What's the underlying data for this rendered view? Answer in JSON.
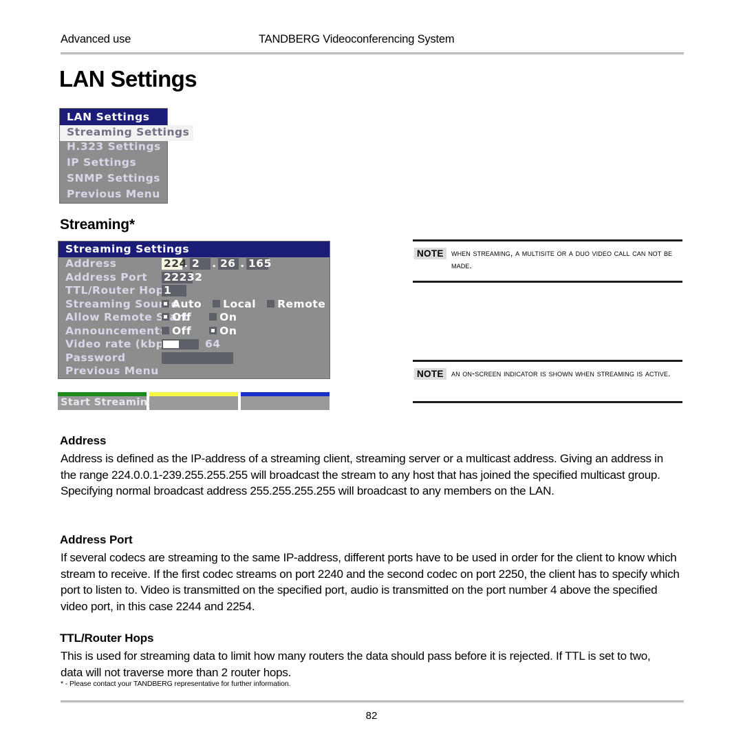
{
  "header": {
    "left": "Advanced use",
    "center": "TANDBERG Videoconferencing System"
  },
  "page_title": "LAN Settings",
  "lan_menu": {
    "title": "LAN Settings",
    "items": [
      {
        "label": "Streaming Settings",
        "selected": true
      },
      {
        "label": "H.323 Settings",
        "selected": false
      },
      {
        "label": "IP Settings",
        "selected": false
      },
      {
        "label": "SNMP Settings",
        "selected": false
      },
      {
        "label": "Previous Menu",
        "selected": false
      }
    ]
  },
  "streaming_section_heading": "Streaming*",
  "streaming_menu": {
    "title": "Streaming Settings",
    "rows": {
      "address": {
        "label": "Address",
        "octets": [
          "224",
          "2",
          "26",
          "165"
        ],
        "separator": ".",
        "active_index": 0
      },
      "address_port": {
        "label": "Address Port",
        "value": "22232"
      },
      "ttl": {
        "label": "TTL/Router Hops",
        "value": "1"
      },
      "streaming_source": {
        "label": "Streaming Source",
        "options": [
          "Auto",
          "Local",
          "Remote"
        ],
        "selected": "Auto"
      },
      "allow_remote_start": {
        "label": "Allow Remote Start",
        "options": [
          "Off",
          "On"
        ],
        "selected": "Off"
      },
      "announcements": {
        "label": "Announcements",
        "options": [
          "Off",
          "On"
        ],
        "selected": "On"
      },
      "video_rate": {
        "label": "Video rate (kbps)",
        "value": "64",
        "fill_percent": 42
      },
      "password": {
        "label": "Password",
        "value": ""
      },
      "previous_menu": {
        "label": "Previous Menu"
      }
    }
  },
  "softkeys": [
    {
      "label": "Start Streaming",
      "color": "#1e8a1e"
    },
    {
      "label": "",
      "color": "#f6f644"
    },
    {
      "label": "",
      "color": "#1730c8"
    }
  ],
  "notes": [
    {
      "badge": "NOTE",
      "text": "When streaming, a MultiSite or a Duo Video call can not be made."
    },
    {
      "badge": "NOTE",
      "text": "An on-screen indicator is shown when streaming is active."
    }
  ],
  "sections": [
    {
      "heading": "Address",
      "text": "Address is defined as the IP-address of a streaming client, streaming server or a multicast address. Giving an address in the range 224.0.0.1-239.255.255.255 will broadcast the stream to any host that has joined the specified multicast group. Specifying normal broadcast address 255.255.255.255 will broadcast to any members on the LAN."
    },
    {
      "heading": "Address Port",
      "text": "If several codecs are streaming to the same IP-address, different ports have to be used in order for the client to know which stream to receive. If the first codec streams on port 2240 and the second codec on port 2250, the client has to specify which port to listen to. Video is transmitted on the specified port, audio is transmitted on the port number 4 above the specified video port, in this case 2244 and 2254."
    },
    {
      "heading": "TTL/Router Hops",
      "text": "This is used for streaming data to limit how many routers the data should pass before it is rejected.  If TTL is set to two, data will not traverse more than 2 router hops."
    }
  ],
  "footnote": "* - Please contact your TANDBERG representative for further information.",
  "page_number": "82"
}
